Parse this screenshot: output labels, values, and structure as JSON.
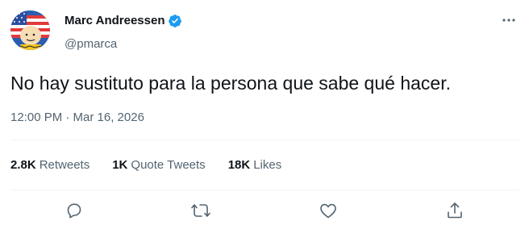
{
  "author": {
    "name": "Marc Andreessen",
    "handle": "@pmarca",
    "verified": true,
    "avatar_icon": "avatar-flag-character-icon"
  },
  "tweet": {
    "text": "No hay sustituto para la persona que sabe qué hacer.",
    "timestamp": "12:00 PM · Mar 16, 2026"
  },
  "stats": [
    {
      "count": "2.8K",
      "label": "Retweets"
    },
    {
      "count": "1K",
      "label": "Quote Tweets"
    },
    {
      "count": "18K",
      "label": "Likes"
    }
  ],
  "actions": [
    "reply-icon",
    "retweet-icon",
    "like-icon",
    "share-icon"
  ],
  "colors": {
    "text": "#0f1419",
    "secondary": "#536471",
    "verified": "#1d9bf0",
    "divider": "#eff3f4"
  }
}
